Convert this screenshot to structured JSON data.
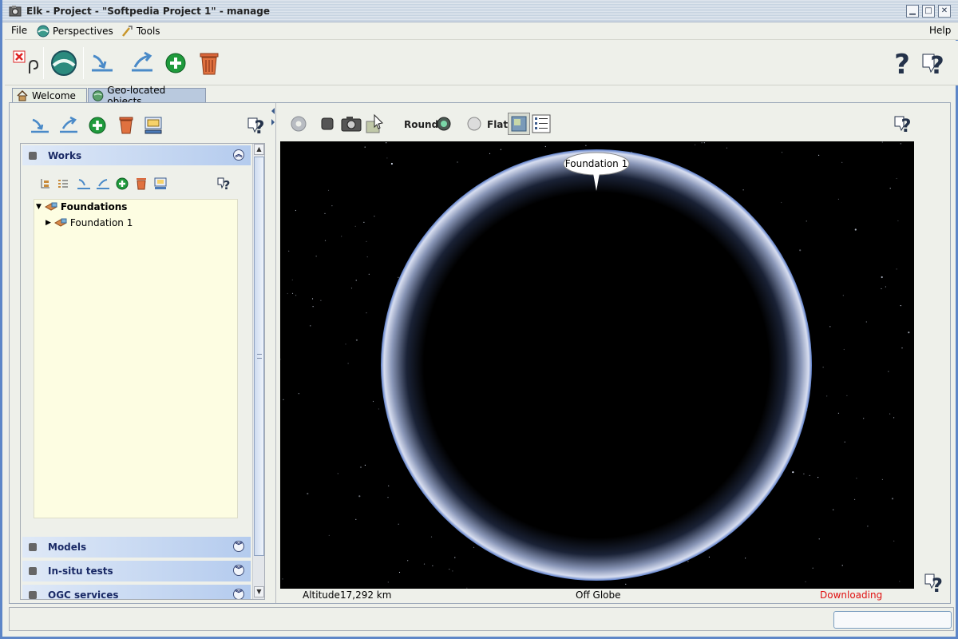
{
  "window": {
    "title": "Elk - Project - \"Softpedia Project 1\" - manage"
  },
  "menu": {
    "file": "File",
    "perspectives": "Perspectives",
    "tools": "Tools",
    "help": "Help"
  },
  "tabs": [
    {
      "label": "Welcome",
      "icon": "home-icon"
    },
    {
      "label": "Geo-located objects",
      "icon": "globe-icon"
    }
  ],
  "works": {
    "title": "Works",
    "tree": [
      {
        "label": "Foundations",
        "expanded": true,
        "bold": true
      },
      {
        "label": "Foundation 1",
        "expanded": false,
        "bold": false
      }
    ]
  },
  "sections": {
    "models": "Models",
    "insitu": "In-situ tests",
    "ogc": "OGC services"
  },
  "globe": {
    "round_label": "Round",
    "flat_label": "Flat",
    "marker_label": "Foundation 1"
  },
  "status": {
    "altitude_label": "Altitude",
    "altitude_value": "17,292 km",
    "position": "Off Globe",
    "download": "Downloading",
    "download_color": "#e01010",
    "progress": 0
  }
}
